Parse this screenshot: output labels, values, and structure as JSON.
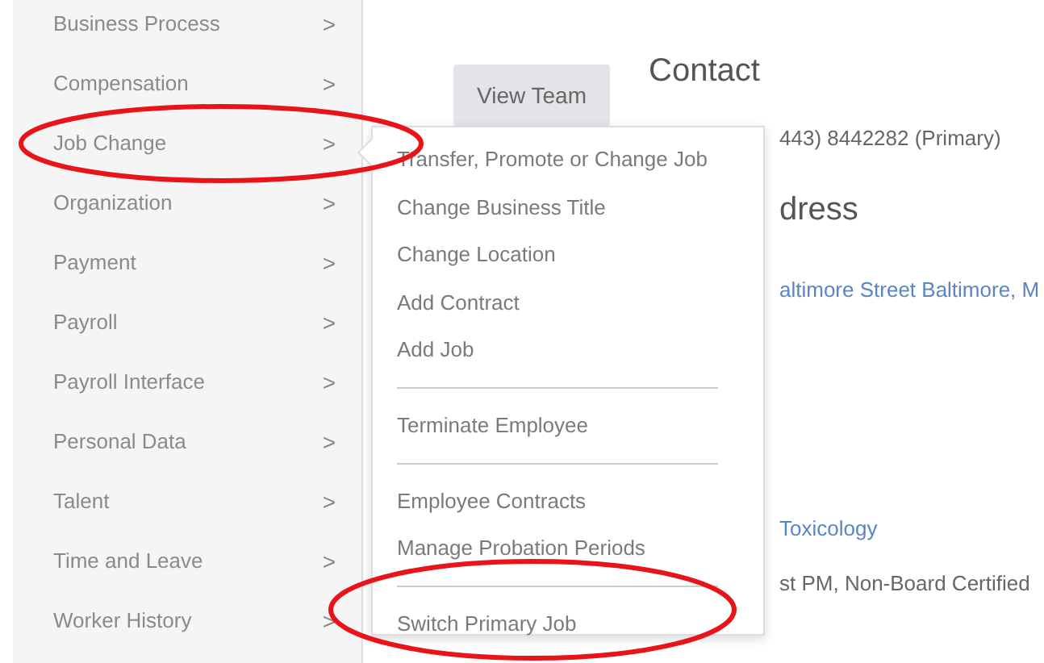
{
  "sidebar": {
    "items": [
      {
        "label": "Business Process",
        "arrow": ">"
      },
      {
        "label": "Compensation",
        "arrow": ">"
      },
      {
        "label": "Job Change",
        "arrow": ">"
      },
      {
        "label": "Organization",
        "arrow": ">"
      },
      {
        "label": "Payment",
        "arrow": ">"
      },
      {
        "label": "Payroll",
        "arrow": ">"
      },
      {
        "label": "Payroll Interface",
        "arrow": ">"
      },
      {
        "label": "Personal Data",
        "arrow": ">"
      },
      {
        "label": "Talent",
        "arrow": ">"
      },
      {
        "label": "Time and Leave",
        "arrow": ">"
      },
      {
        "label": "Worker History",
        "arrow": ">"
      }
    ]
  },
  "main": {
    "view_team_button": "View Team",
    "contact_heading": "Contact",
    "phone": "443) 8442282 (Primary)",
    "address_heading": "dress",
    "address_link": "altimore Street Baltimore, M",
    "department_link": "Toxicology",
    "position": "st PM, Non-Board Certified"
  },
  "popup_menu": {
    "groups": [
      [
        "Transfer, Promote or Change Job",
        "Change Business Title",
        "Change Location",
        "Add Contract",
        "Add Job"
      ],
      [
        "Terminate Employee"
      ],
      [
        "Employee Contracts",
        "Manage Probation Periods"
      ],
      [
        "Switch Primary Job"
      ]
    ]
  }
}
